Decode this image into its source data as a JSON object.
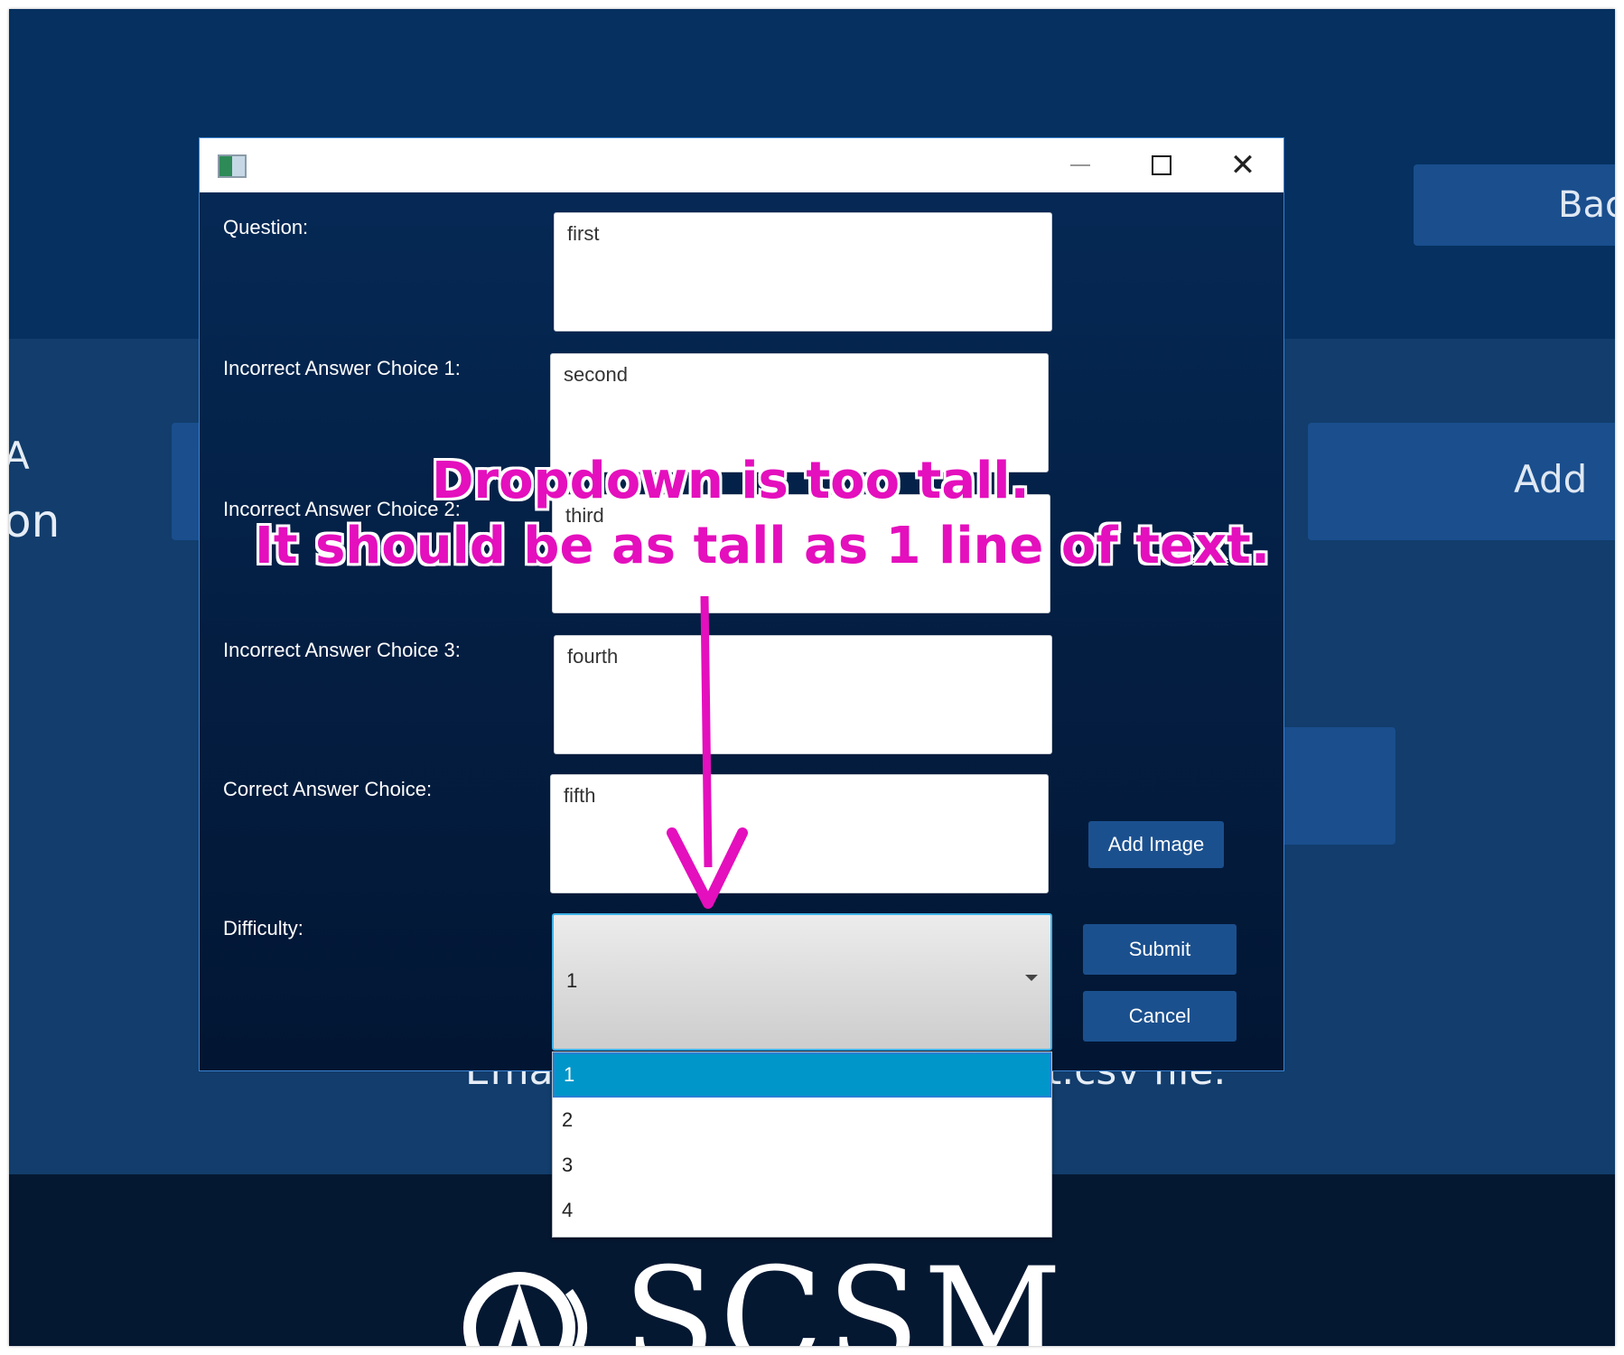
{
  "background": {
    "back_label": "Back",
    "add_label": "Add",
    "left_text_a": "A",
    "left_text_on": "on",
    "csv_left": "Ema",
    "csv_right": "t.csv file.",
    "logo_text": "SCSM"
  },
  "dialog": {
    "labels": {
      "question": "Question:",
      "incorrect1": "Incorrect Answer Choice 1:",
      "incorrect2": "Incorrect Answer Choice 2:",
      "incorrect3": "Incorrect Answer Choice 3:",
      "correct": "Correct Answer Choice:",
      "difficulty": "Difficulty:"
    },
    "values": {
      "question": "first",
      "incorrect1": "second",
      "incorrect2": "third",
      "incorrect3": "fourth",
      "correct": "fifth"
    },
    "difficulty": {
      "selected": "1",
      "options": [
        "1",
        "2",
        "3",
        "4"
      ]
    },
    "buttons": {
      "add_image": "Add Image",
      "submit": "Submit",
      "cancel": "Cancel"
    }
  },
  "annotation": {
    "line1": "Dropdown is too tall.",
    "line2": "It should be as tall as 1 line of text.",
    "color": "#e40fbd"
  }
}
